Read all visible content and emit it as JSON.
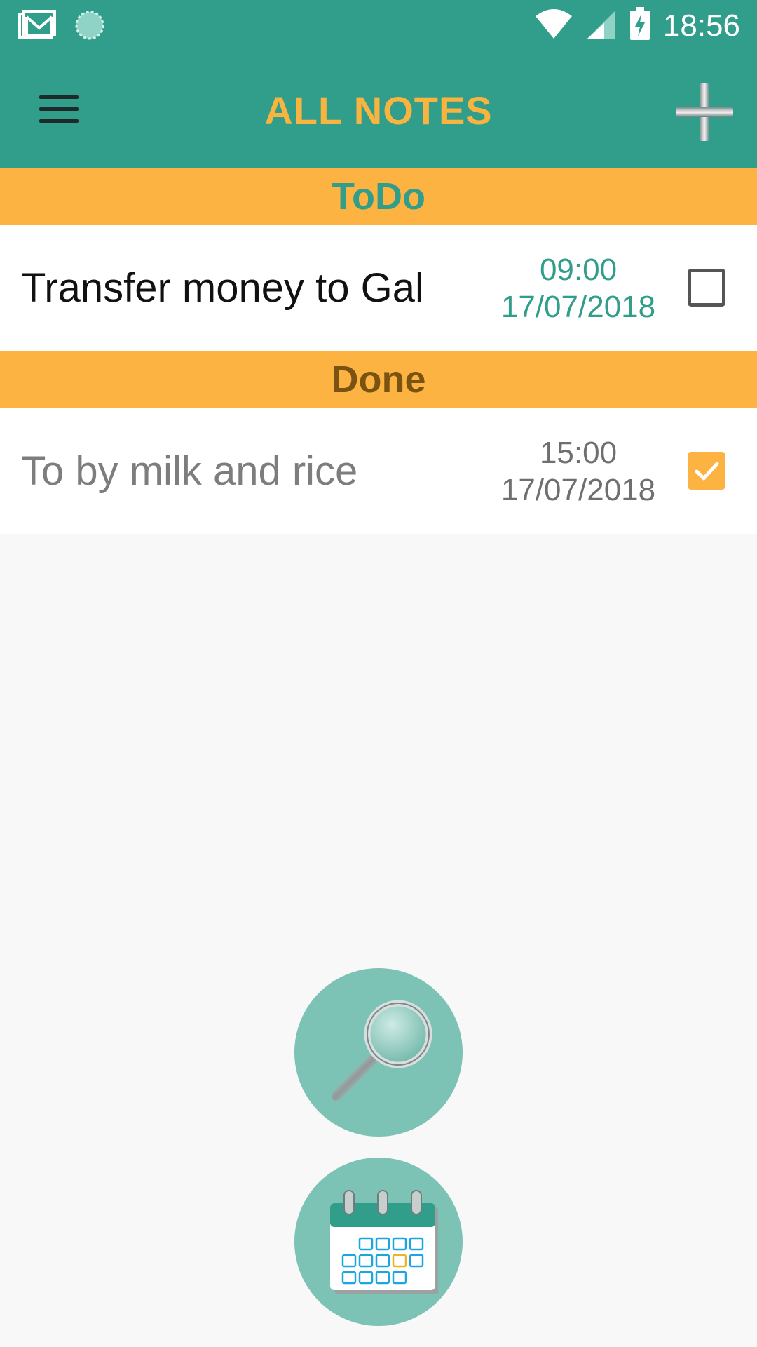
{
  "status_bar": {
    "time": "18:56",
    "icons": [
      "gmail-icon",
      "sync-icon",
      "wifi-icon",
      "signal-icon",
      "battery-charging-icon"
    ]
  },
  "app_bar": {
    "title": "ALL NOTES",
    "menu_icon": "hamburger-menu-icon",
    "add_icon": "plus-icon"
  },
  "sections": {
    "todo": {
      "header": "ToDo",
      "notes": [
        {
          "text": "Transfer money to Gal",
          "time": "09:00",
          "date": "17/07/2018",
          "checked": false
        }
      ]
    },
    "done": {
      "header": "Done",
      "notes": [
        {
          "text": "To by milk and rice",
          "time": "15:00",
          "date": "17/07/2018",
          "checked": true
        }
      ]
    }
  },
  "fabs": {
    "search_icon": "magnifier-icon",
    "calendar_icon": "calendar-icon"
  },
  "colors": {
    "primary": "#319e8b",
    "accent": "#fdb342",
    "title": "#f9b440",
    "fab": "#7cc2b5"
  }
}
